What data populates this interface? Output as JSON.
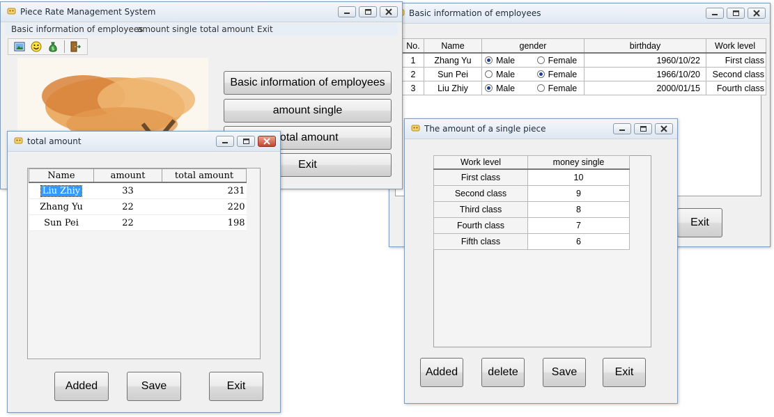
{
  "main_window": {
    "title": "Piece Rate Management System",
    "menu": [
      "Basic information of employees",
      "amount single",
      "total amount",
      "Exit"
    ],
    "toolbar": [
      "picture-icon",
      "smiley-icon",
      "money-bag-icon",
      "exit-door-icon"
    ],
    "buttons": {
      "basic_info": "Basic information of employees",
      "amount_single": "amount single",
      "total_amount": "total amount",
      "exit": "Exit"
    }
  },
  "employees_window": {
    "title": "Basic information of employees",
    "columns": [
      "No.",
      "Name",
      "gender",
      "birthday",
      "Work level"
    ],
    "gender_options": [
      "Male",
      "Female"
    ],
    "rows": [
      {
        "no": "1",
        "name": "Zhang Yu",
        "gender": "Male",
        "birthday": "1960/10/22",
        "level": "First class"
      },
      {
        "no": "2",
        "name": "Sun Pei",
        "gender": "Female",
        "birthday": "1966/10/20",
        "level": "Second class"
      },
      {
        "no": "3",
        "name": "Liu Zhiy",
        "gender": "Male",
        "birthday": "2000/01/15",
        "level": "Fourth class"
      }
    ],
    "exit_label": "Exit"
  },
  "single_window": {
    "title": "The amount of a single piece",
    "columns": [
      "Work level",
      "money single"
    ],
    "rows": [
      {
        "level": "First class",
        "money": "10"
      },
      {
        "level": "Second class",
        "money": "9"
      },
      {
        "level": "Third class",
        "money": "8"
      },
      {
        "level": "Fourth class",
        "money": "7"
      },
      {
        "level": "Fifth class",
        "money": "6"
      }
    ],
    "buttons": {
      "added": "Added",
      "delete": "delete",
      "save": "Save",
      "exit": "Exit"
    }
  },
  "total_window": {
    "title": "total amount",
    "columns": [
      "Name",
      "amount",
      "total  amount"
    ],
    "rows": [
      {
        "name": "Liu Zhiy",
        "amount": "33",
        "total": "231",
        "selected": true
      },
      {
        "name": "Zhang Yu",
        "amount": "22",
        "total": "220",
        "selected": false
      },
      {
        "name": "Sun Pei",
        "amount": "22",
        "total": "198",
        "selected": false
      }
    ],
    "buttons": {
      "added": "Added",
      "save": "Save",
      "exit": "Exit"
    }
  },
  "colors": {
    "title_bar": "#dfe8f2",
    "close_button_active": "#c4452d",
    "selection": "#3399ff",
    "radio_dot": "#1b3f8f"
  }
}
